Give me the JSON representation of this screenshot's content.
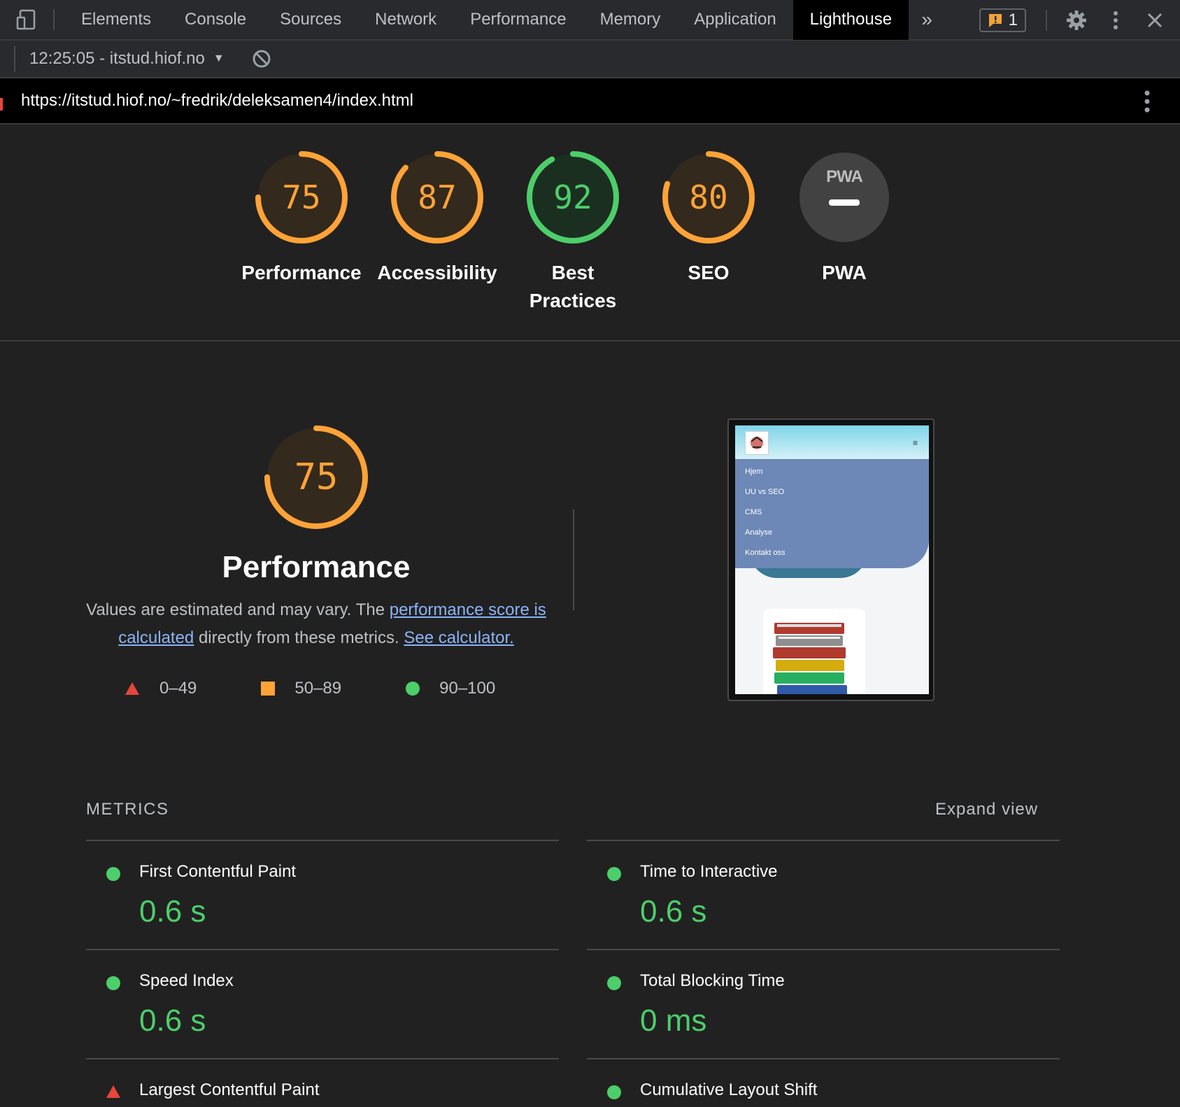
{
  "devtools": {
    "tabs": [
      "Elements",
      "Console",
      "Sources",
      "Network",
      "Performance",
      "Memory",
      "Application",
      "Lighthouse"
    ],
    "active_tab": "Lighthouse",
    "issues_count": "1"
  },
  "report": {
    "selector_label": "12:25:05 - itstud.hiof.no",
    "url": "https://itstud.hiof.no/~fredrik/deleksamen4/index.html"
  },
  "categories": [
    {
      "label": "Performance",
      "score": "75",
      "value": 75,
      "color": "#ffa337"
    },
    {
      "label": "Accessibility",
      "score": "87",
      "value": 87,
      "color": "#ffa337"
    },
    {
      "label": "Best Practices",
      "score": "92",
      "value": 92,
      "color": "#4cce6a"
    },
    {
      "label": "SEO",
      "score": "80",
      "value": 80,
      "color": "#ffa337"
    },
    {
      "label": "PWA",
      "score": "",
      "value": 0,
      "color": "#5f6368"
    }
  ],
  "performance": {
    "score": "75",
    "value": 75,
    "title": "Performance",
    "desc_prefix": "Values are estimated and may vary. The ",
    "link1": "performance score is calculated",
    "desc_mid": " directly from these metrics. ",
    "link2": "See calculator.",
    "legend": [
      "0–49",
      "50–89",
      "90–100"
    ]
  },
  "thumbnail": {
    "menu": [
      "Hjem",
      "UU vs SEO",
      "CMS",
      "Analyse",
      "Kontakt oss"
    ]
  },
  "metrics": {
    "heading": "METRICS",
    "expand_label": "Expand view",
    "items": [
      {
        "name": "First Contentful Paint",
        "value": "0.6 s",
        "status": "pass"
      },
      {
        "name": "Time to Interactive",
        "value": "0.6 s",
        "status": "pass"
      },
      {
        "name": "Speed Index",
        "value": "0.6 s",
        "status": "pass"
      },
      {
        "name": "Total Blocking Time",
        "value": "0 ms",
        "status": "pass"
      },
      {
        "name": "Largest Contentful Paint",
        "value": "",
        "status": "fail"
      },
      {
        "name": "Cumulative Layout Shift",
        "value": "",
        "status": "pass"
      }
    ]
  },
  "colors": {
    "pass": "#4cce6a",
    "average": "#ffa337",
    "fail": "#e8453c",
    "link": "#8ab4f8"
  }
}
